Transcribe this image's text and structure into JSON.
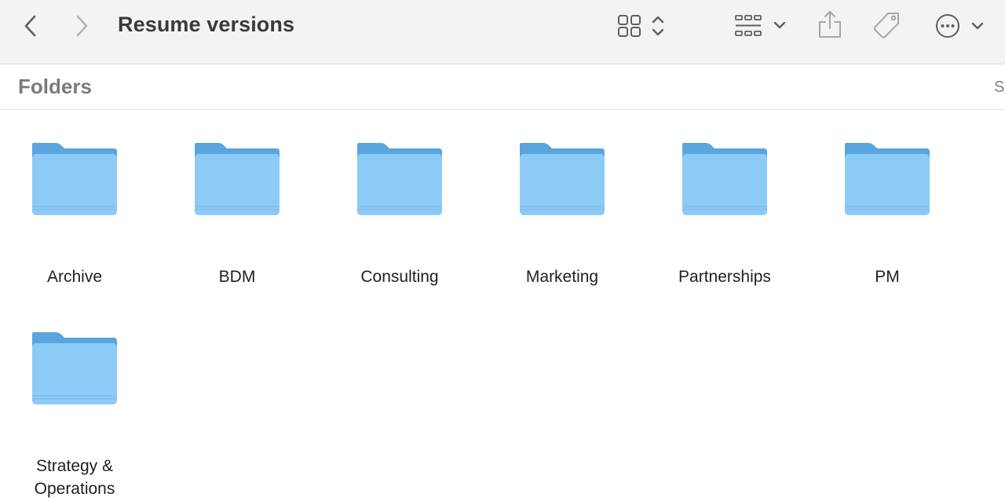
{
  "toolbar": {
    "title": "Resume versions",
    "icons": {
      "back": "chevron-left-icon",
      "forward": "chevron-right-icon",
      "view": "icon-grid-view-icon",
      "group": "group-by-icon",
      "share": "share-icon",
      "tag": "tag-icon",
      "more": "ellipsis-circle-icon"
    }
  },
  "section": {
    "title": "Folders",
    "action": "S"
  },
  "folders": [
    {
      "name": "Archive"
    },
    {
      "name": "BDM"
    },
    {
      "name": "Consulting"
    },
    {
      "name": "Marketing"
    },
    {
      "name": "Partnerships"
    },
    {
      "name": "PM"
    },
    {
      "name": "Strategy & Operations"
    }
  ],
  "colors": {
    "folder_front": "#8ccbf6",
    "folder_back": "#5aa5e0",
    "toolbar_bg": "#f3f3f2",
    "icon_gray": "#6f6f6f"
  }
}
